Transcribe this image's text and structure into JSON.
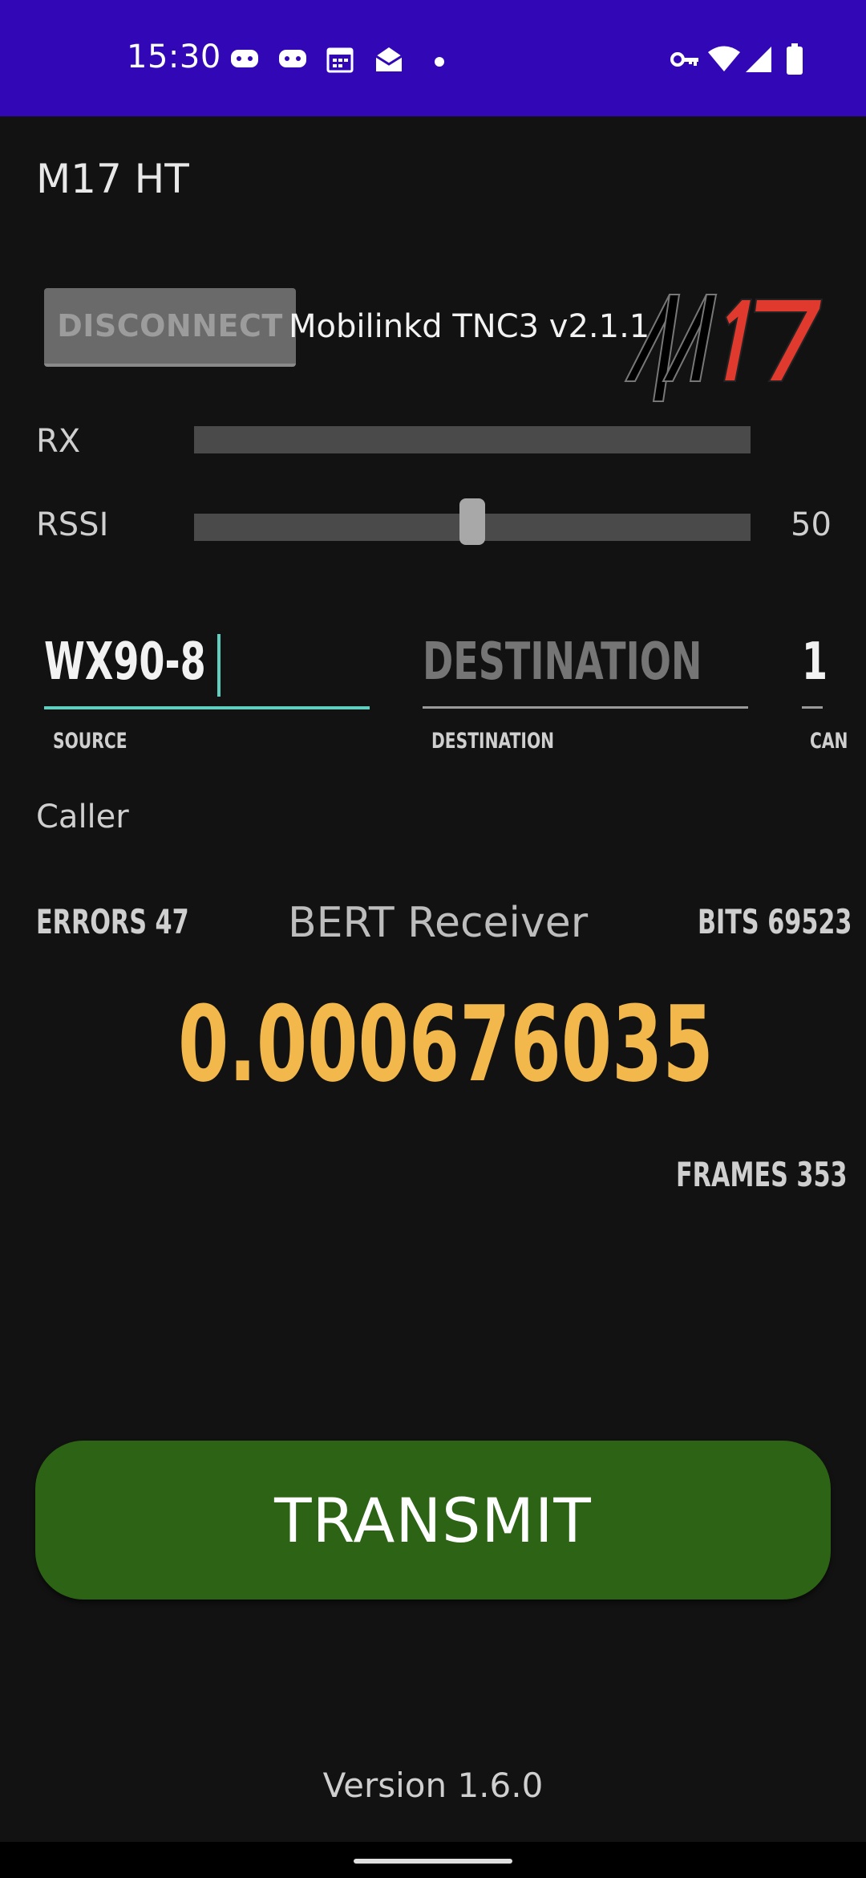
{
  "status_bar": {
    "time": "15:30",
    "bg_color": "#3208b6",
    "left_icons": [
      "game-controller-icon",
      "game-controller-icon",
      "calendar-icon",
      "mail-open-icon",
      "dot-icon"
    ],
    "right_icons": [
      "vpn-key-icon",
      "wifi-icon",
      "signal-icon",
      "battery-icon"
    ]
  },
  "app": {
    "title": "M17 HT"
  },
  "connection": {
    "disconnect_label": "DISCONNECT",
    "device_name": "Mobilinkd TNC3 v2.1.1"
  },
  "logo": {
    "text_m": "M",
    "text_17": "17",
    "accent_color": "#e03a2e"
  },
  "rx": {
    "label": "RX"
  },
  "rssi": {
    "label": "RSSI",
    "value": "50",
    "level_fraction": 0.5
  },
  "source": {
    "value": "WX90-8",
    "caption": "SOURCE"
  },
  "destination": {
    "placeholder": "DESTINATION",
    "caption": "DESTINATION"
  },
  "can": {
    "value": "1",
    "caption": "CAN"
  },
  "caller": {
    "label": "Caller"
  },
  "bert": {
    "title": "BERT Receiver",
    "errors": "ERRORS 47",
    "bits": "BITS 69523",
    "ber": "0.000676035",
    "frames": "FRAMES 353",
    "ber_color": "#f2b84b"
  },
  "transmit": {
    "label": "TRANSMIT",
    "color": "#2d6314"
  },
  "footer": {
    "version": "Version 1.6.0"
  }
}
